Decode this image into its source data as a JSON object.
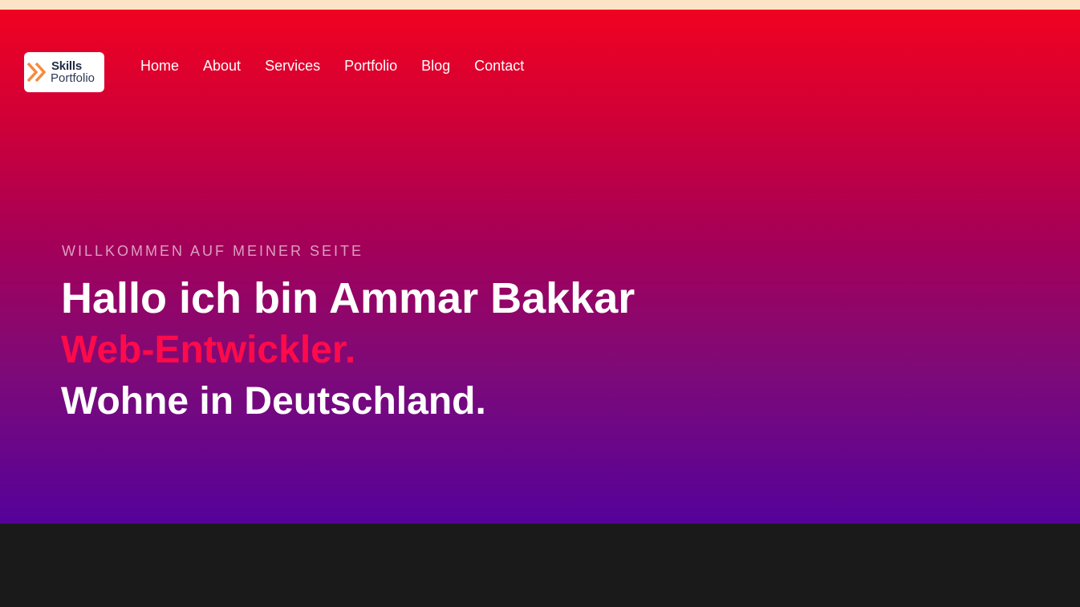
{
  "logo": {
    "line1": "Skills",
    "line2": "Portfolio",
    "chevron_color": "#f58a3c"
  },
  "nav": {
    "items": [
      "Home",
      "About",
      "Services",
      "Portfolio",
      "Blog",
      "Contact"
    ]
  },
  "hero": {
    "eyebrow": "WILLKOMMEN AUF MEINER SEITE",
    "headline": "Hallo ich bin Ammar Bakkar",
    "role": "Web-Entwickler.",
    "location": "Wohne in Deutschland.",
    "gradient_top": "#f00221",
    "gradient_bottom": "#55029a",
    "accent": "#ff0a4a"
  },
  "footer": {
    "background": "#1a1a1a"
  }
}
